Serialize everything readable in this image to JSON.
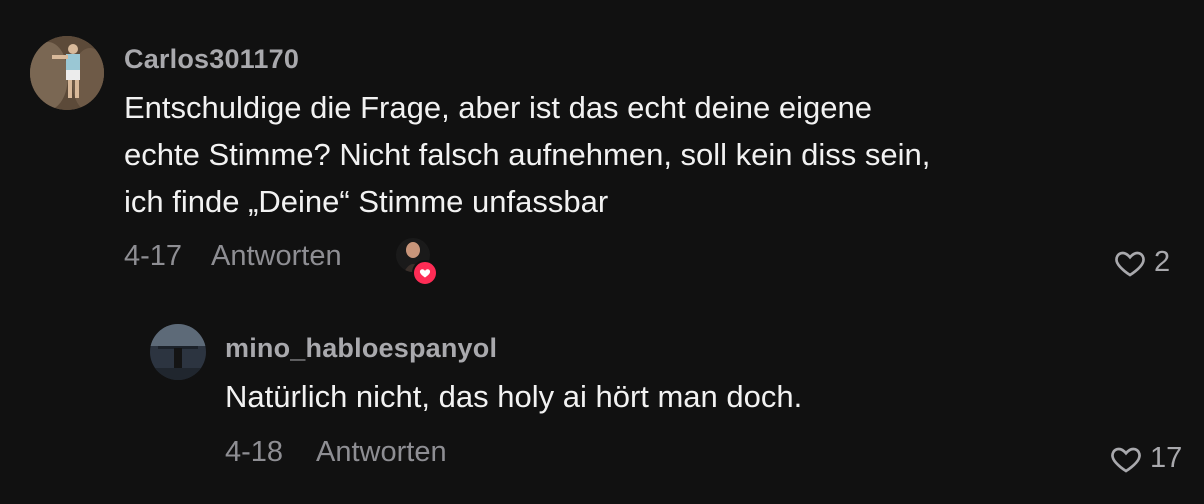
{
  "comments": [
    {
      "username": "Carlos301170",
      "lines": [
        "Entschuldige die Frage, aber ist das echt deine eigene",
        "echte Stimme? Nicht falsch aufnehmen, soll kein diss sein,",
        "ich finde „Deine“ Stimme unfassbar"
      ],
      "date": "4-17",
      "reply_label": "Antworten",
      "likes": "2",
      "creator_liked": true
    },
    {
      "username": "mino_habloespanyol",
      "lines": [
        "Natürlich nicht, das holy ai hört man doch."
      ],
      "date": "4-18",
      "reply_label": "Antworten",
      "likes": "17"
    }
  ],
  "colors": {
    "background": "#111111",
    "username": "#a9a9ad",
    "meta": "#8e8e93",
    "heart_badge": "#fe2c55"
  },
  "icons": {
    "like": "heart-outline-icon",
    "creator_like": "heart-filled-icon"
  }
}
